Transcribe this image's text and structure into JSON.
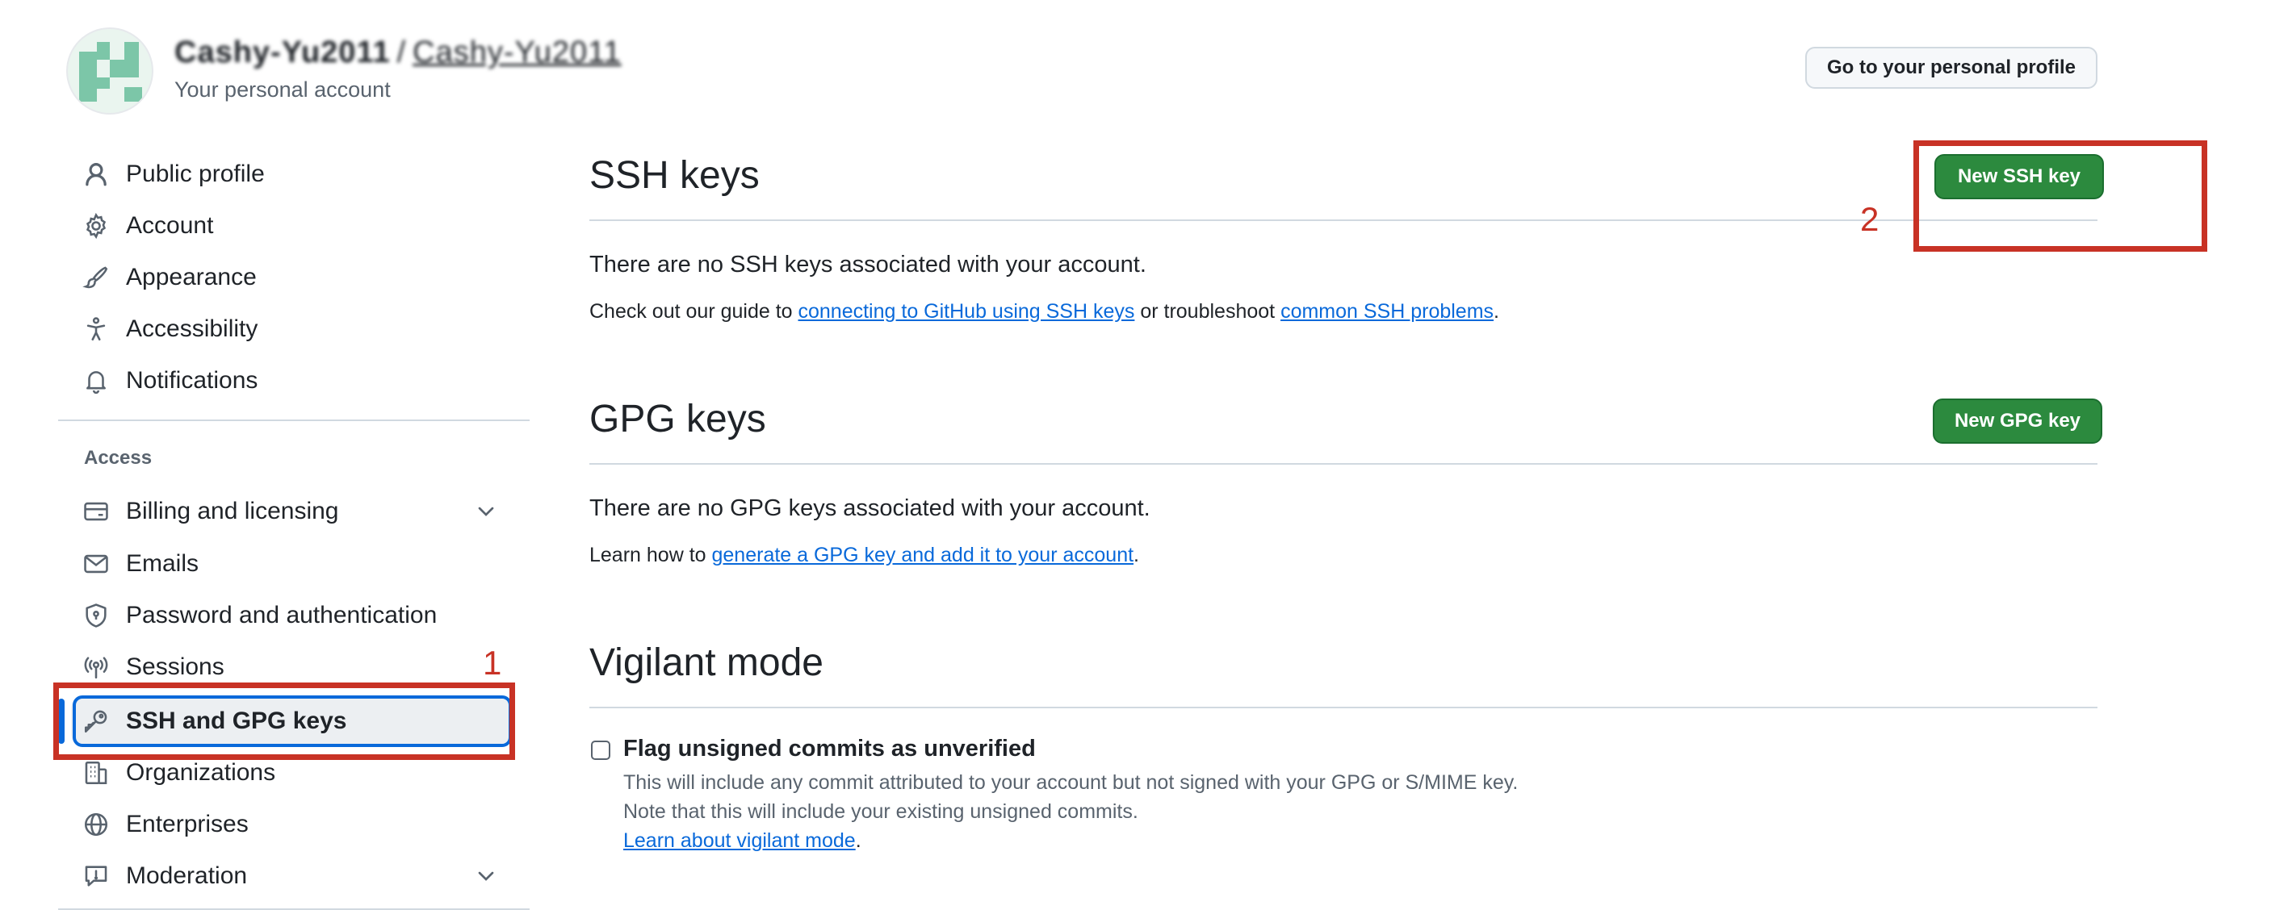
{
  "header": {
    "account_name": "Cashy-Yu2011 / Cashy-Yu2011",
    "account_name_primary": "Cashy-Yu2011",
    "account_name_secondary": "Cashy-Yu2011",
    "account_subtitle": "Your personal account",
    "profile_button": "Go to your personal profile"
  },
  "sidebar": {
    "items": [
      {
        "label": "Public profile",
        "icon": "person-icon"
      },
      {
        "label": "Account",
        "icon": "gear-icon"
      },
      {
        "label": "Appearance",
        "icon": "paintbrush-icon"
      },
      {
        "label": "Accessibility",
        "icon": "accessibility-icon"
      },
      {
        "label": "Notifications",
        "icon": "bell-icon"
      }
    ],
    "access_heading": "Access",
    "access_items": [
      {
        "label": "Billing and licensing",
        "icon": "credit-card-icon",
        "expandable": true
      },
      {
        "label": "Emails",
        "icon": "mail-icon"
      },
      {
        "label": "Password and authentication",
        "icon": "shield-lock-icon"
      },
      {
        "label": "Sessions",
        "icon": "broadcast-icon"
      },
      {
        "label": "SSH and GPG keys",
        "icon": "key-icon",
        "active": true
      },
      {
        "label": "Organizations",
        "icon": "organization-icon"
      },
      {
        "label": "Enterprises",
        "icon": "globe-icon"
      },
      {
        "label": "Moderation",
        "icon": "report-icon",
        "expandable": true
      }
    ]
  },
  "ssh": {
    "title": "SSH keys",
    "new_button": "New SSH key",
    "empty_text": "There are no SSH keys associated with your account.",
    "guide_prefix": "Check out our guide to ",
    "guide_link": "connecting to GitHub using SSH keys",
    "guide_middle": " or troubleshoot ",
    "troubleshoot_link": "common SSH problems",
    "guide_suffix": "."
  },
  "gpg": {
    "title": "GPG keys",
    "new_button": "New GPG key",
    "empty_text": "There are no GPG keys associated with your account.",
    "learn_prefix": "Learn how to ",
    "learn_link": "generate a GPG key and add it to your account",
    "learn_suffix": "."
  },
  "vigilant": {
    "title": "Vigilant mode",
    "checkbox_label": "Flag unsigned commits as unverified",
    "checkbox_checked": false,
    "note_line1": "This will include any commit attributed to your account but not signed with your GPG or S/MIME key.",
    "note_line2": "Note that this will include your existing unsigned commits.",
    "learn_link": "Learn about vigilant mode",
    "learn_suffix": "."
  },
  "annotations": {
    "step1": "1",
    "step2": "2",
    "color": "#c83225"
  },
  "colors": {
    "primary_button": "#2c8a3e",
    "link": "#0969da",
    "active_indicator": "#0969da",
    "annotation": "#c83225"
  }
}
